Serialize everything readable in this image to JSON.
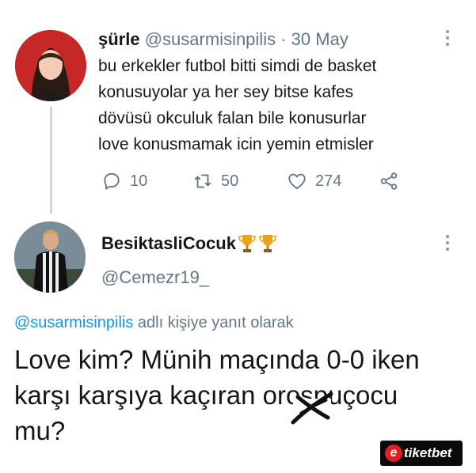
{
  "tweet1": {
    "display_name": "şürle",
    "handle": "@susarmisinpilis",
    "separator": "·",
    "date": "30 May",
    "text_lines": [
      "bu erkekler futbol bitti simdi de basket",
      "konusuyolar ya her sey bitse kafes",
      "dövüsü okculuk falan bile konusurlar",
      "love konusmamak icin yemin etmisler"
    ],
    "replies": "10",
    "retweets": "50",
    "likes": "274"
  },
  "tweet2": {
    "display_name": "BesiktasliCocuk",
    "handle": "@Cemezr19_",
    "reply_prefix_mention": "@susarmisinpilis",
    "reply_prefix_text": "adlı kişiye yanıt olarak",
    "text_lines": [
      "Love kim? Münih maçında 0-0 iken",
      "karşı karşıya kaçıran orospuçocu",
      "mu?"
    ]
  },
  "watermark": {
    "icon_letter": "e",
    "brand": "tiketbet"
  },
  "colors": {
    "text": "#14171a",
    "muted": "#657786",
    "link": "#1b95e0",
    "brand_red": "#e21d24"
  },
  "icons": [
    "more-icon",
    "reply-icon",
    "retweet-icon",
    "like-icon",
    "share-icon",
    "trophy-icon"
  ]
}
